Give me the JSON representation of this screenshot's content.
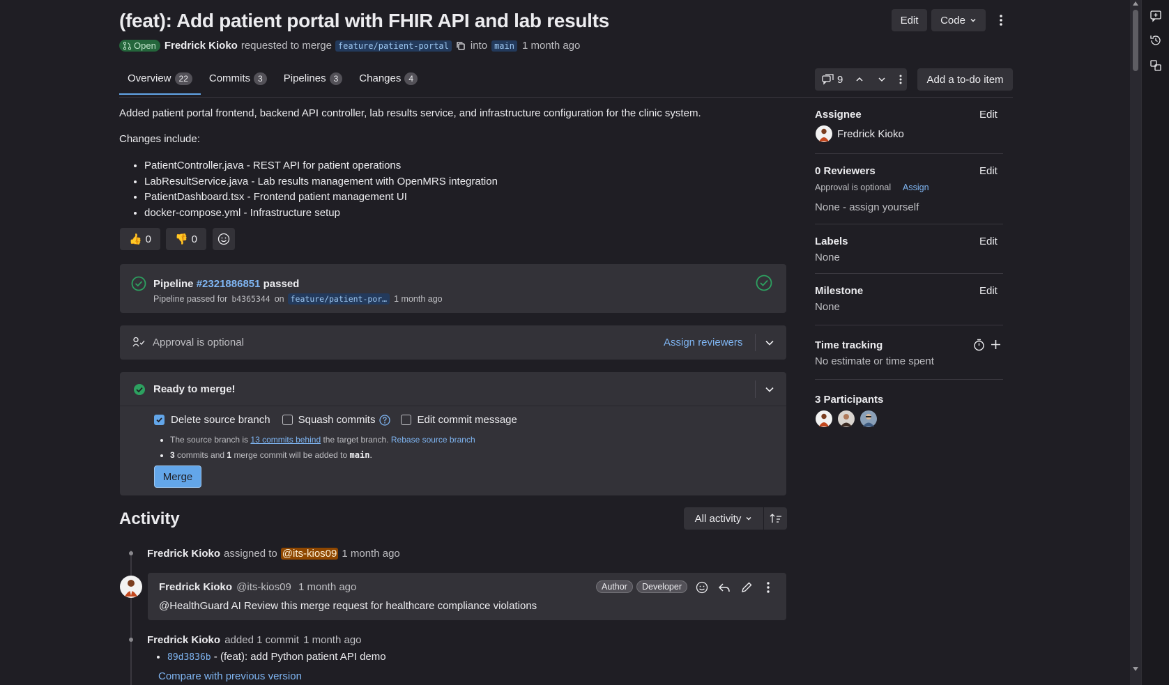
{
  "header": {
    "title": "(feat): Add patient portal with FHIR API and lab results",
    "status": "Open",
    "author": "Fredrick Kioko",
    "requested_text": "requested to merge",
    "source_branch": "feature/patient-portal",
    "into_text": "into",
    "target_branch": "main",
    "time": "1 month ago",
    "edit_label": "Edit",
    "code_label": "Code"
  },
  "tabs": [
    {
      "label": "Overview",
      "count": "22"
    },
    {
      "label": "Commits",
      "count": "3"
    },
    {
      "label": "Pipelines",
      "count": "3"
    },
    {
      "label": "Changes",
      "count": "4"
    }
  ],
  "toolbar": {
    "comments_count": "9",
    "todo_label": "Add a to-do item"
  },
  "description": {
    "intro": "Added patient portal frontend, backend API controller, lab results service, and infrastructure configuration for the clinic system.",
    "changes_heading": "Changes include:",
    "items": [
      "PatientController.java - REST API for patient operations",
      "LabResultService.java - Lab results management with OpenMRS integration",
      "PatientDashboard.tsx - Frontend patient management UI",
      "docker-compose.yml - Infrastructure setup"
    ]
  },
  "reactions": {
    "thumbs_up": "0",
    "thumbs_down": "0"
  },
  "pipeline": {
    "label": "Pipeline",
    "id": "#2321886851",
    "status": "passed",
    "sub_prefix": "Pipeline passed for",
    "commit": "b4365344",
    "on_text": "on",
    "branch": "feature/patient-por…",
    "time": "1 month ago"
  },
  "approval": {
    "text": "Approval is optional",
    "assign_label": "Assign reviewers"
  },
  "merge": {
    "title": "Ready to merge!",
    "delete_branch": "Delete source branch",
    "squash": "Squash commits",
    "edit_message": "Edit commit message",
    "note1_prefix": "The source branch is",
    "note1_link": "13 commits behind",
    "note1_mid": "the target branch.",
    "note1_rebase": "Rebase source branch",
    "note2_n1": "3",
    "note2_a": "commits and",
    "note2_n2": "1",
    "note2_b": "merge commit will be added to",
    "note2_branch": "main",
    "note2_end": ".",
    "button": "Merge"
  },
  "activity": {
    "heading": "Activity",
    "filter": "All activity",
    "item1": {
      "author": "Fredrick Kioko",
      "text": "assigned to",
      "mention": "@its-kios09",
      "time": "1 month ago"
    },
    "comment": {
      "author": "Fredrick Kioko",
      "handle": "@its-kios09",
      "time": "1 month ago",
      "badge_author": "Author",
      "badge_role": "Developer",
      "body": "@HealthGuard AI Review this merge request for healthcare compliance violations"
    },
    "item3": {
      "author": "Fredrick Kioko",
      "text": "added 1 commit",
      "time": "1 month ago",
      "commit_sha": "89d3836b",
      "commit_msg": "- (feat): add Python patient API demo",
      "compare": "Compare with previous version"
    }
  },
  "sidebar": {
    "assignee": {
      "title": "Assignee",
      "edit": "Edit",
      "name": "Fredrick Kioko"
    },
    "reviewers": {
      "title": "0 Reviewers",
      "edit": "Edit",
      "optional": "Approval is optional",
      "assign": "Assign",
      "none": "None - assign yourself"
    },
    "labels": {
      "title": "Labels",
      "edit": "Edit",
      "value": "None"
    },
    "milestone": {
      "title": "Milestone",
      "edit": "Edit",
      "value": "None"
    },
    "time_tracking": {
      "title": "Time tracking",
      "value": "No estimate or time spent"
    },
    "participants": {
      "title": "3 Participants"
    }
  },
  "colors": {
    "background": "#1f1e24",
    "card": "#333238",
    "link": "#7fb5f2",
    "success": "#2da160",
    "merge_button": "#63a6e9"
  }
}
